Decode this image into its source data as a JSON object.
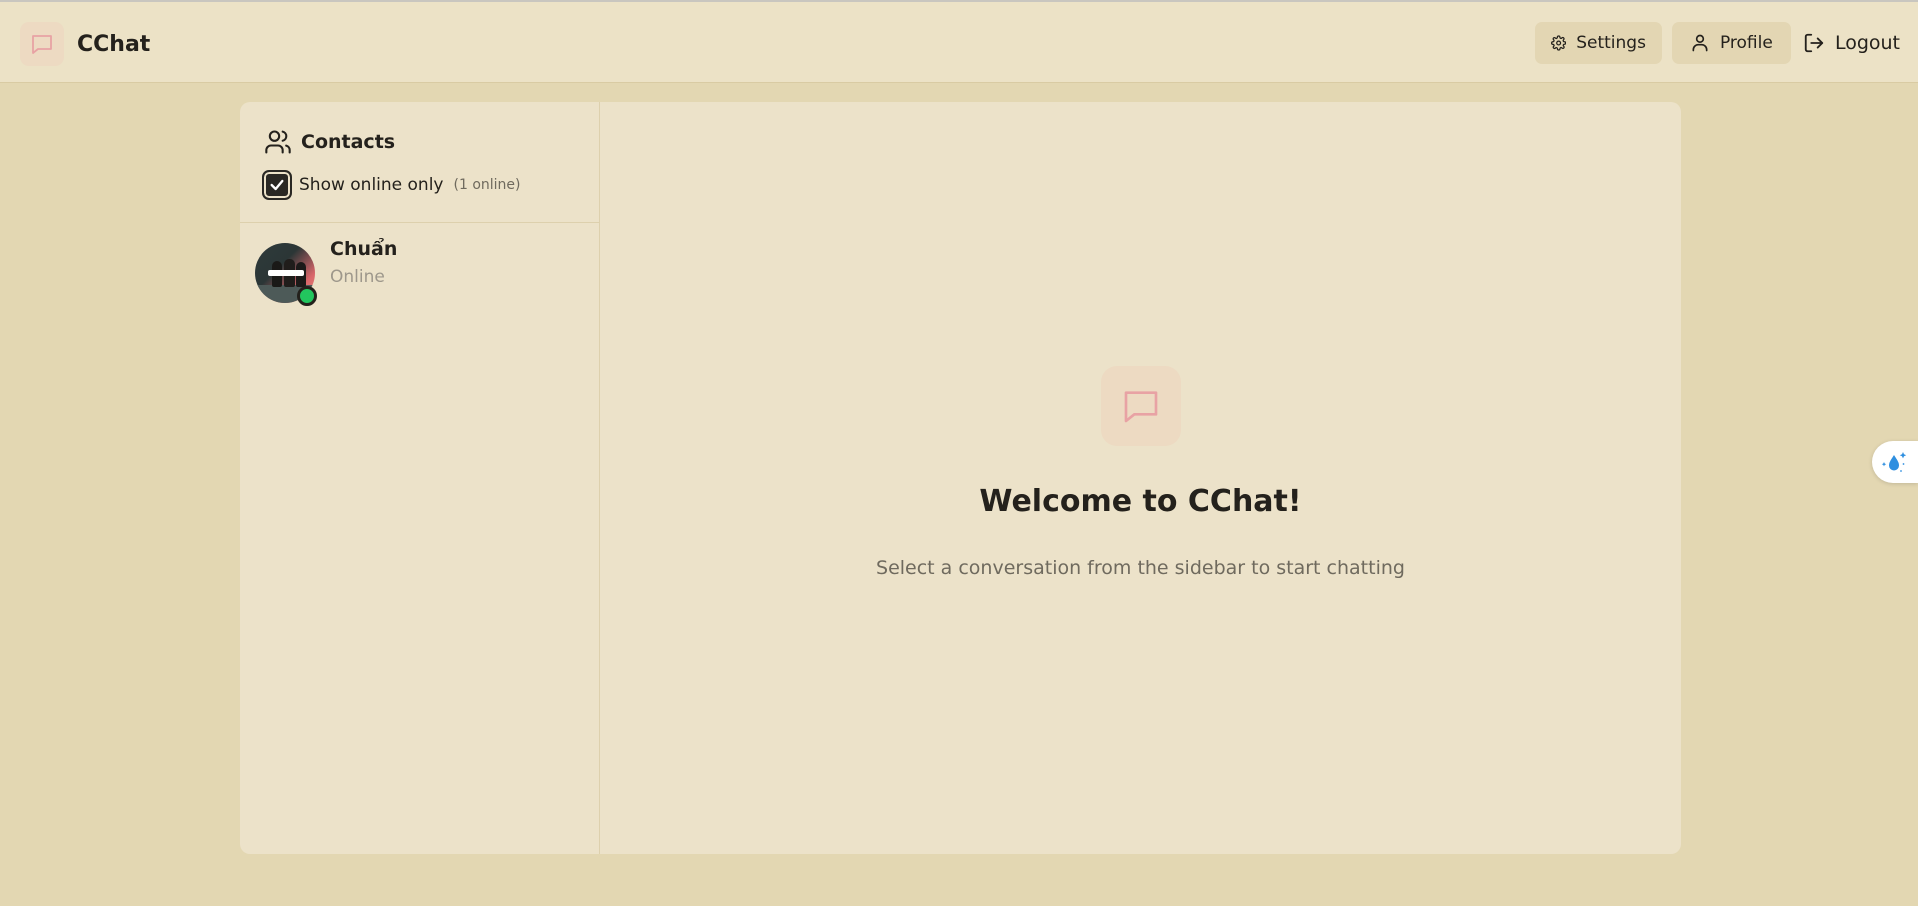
{
  "app": {
    "title": "CChat",
    "logo_icon": "message-square-icon",
    "accent_color": "#e8a2a4"
  },
  "nav": {
    "settings_label": "Settings",
    "settings_icon": "gear-icon",
    "profile_label": "Profile",
    "profile_icon": "user-icon",
    "logout_label": "Logout",
    "logout_icon": "logout-icon"
  },
  "sidebar": {
    "title": "Contacts",
    "title_icon": "users-icon",
    "filter_label": "Show online only",
    "filter_checked": true,
    "online_count": "(1 online)",
    "contacts": [
      {
        "name": "Chuẩn",
        "status": "Online",
        "status_color": "#22c55e"
      }
    ]
  },
  "main": {
    "welcome_icon": "message-square-icon",
    "welcome_title": "Welcome to CChat!",
    "welcome_subtitle": "Select a conversation from the sidebar to start chatting"
  },
  "floating": {
    "icon": "water-drop-sparkle-icon"
  }
}
